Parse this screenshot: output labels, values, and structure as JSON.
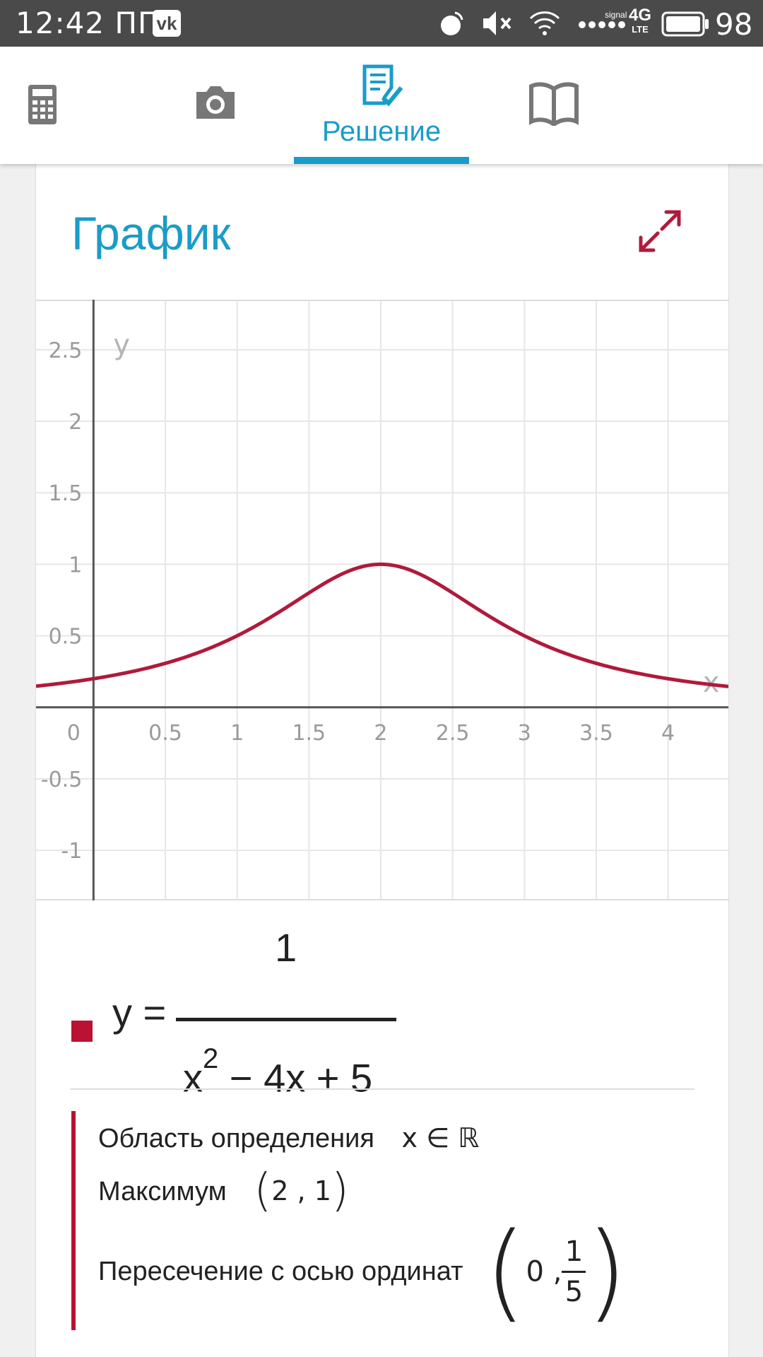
{
  "status_bar": {
    "time": "12:42 ПП",
    "network_small": "signal",
    "network": "4G",
    "network_sub": "LTE",
    "battery": "98"
  },
  "tabs": [
    {
      "icon": "calculator-icon",
      "label": "",
      "active": false
    },
    {
      "icon": "camera-icon",
      "label": "",
      "active": false
    },
    {
      "icon": "solution-icon",
      "label": "Решение",
      "active": true
    },
    {
      "icon": "book-icon",
      "label": "",
      "active": false
    }
  ],
  "card": {
    "title": "График"
  },
  "colors": {
    "accent": "#1a9cc8",
    "curve": "#b01a3c",
    "legend": "#bb1133"
  },
  "chart_data": {
    "type": "line",
    "xlabel": "x",
    "ylabel": "y",
    "xlim": [
      -0.4,
      4.42
    ],
    "ylim": [
      -1.35,
      2.85
    ],
    "x_ticks": [
      "0",
      "0.5",
      "1",
      "1.5",
      "2",
      "2.5",
      "3",
      "3.5",
      "4"
    ],
    "y_ticks": [
      "2.5",
      "2",
      "1.5",
      "1",
      "0.5",
      "-0.5",
      "-1"
    ],
    "series": [
      {
        "function": "1/(x^2-4x+5)",
        "x": [
          -0.4,
          0,
          0.5,
          1,
          1.5,
          2,
          2.5,
          3,
          3.5,
          4,
          4.42
        ],
        "y": [
          0.148,
          0.2,
          0.308,
          0.5,
          0.8,
          1.0,
          0.8,
          0.5,
          0.308,
          0.2,
          0.146
        ]
      }
    ],
    "grid": true
  },
  "formula": {
    "lhs": "y =",
    "numerator": "1",
    "den_base": "x",
    "den_exp": "2",
    "den_rest": " − 4x + 5"
  },
  "properties": {
    "domain_label": "Область определения",
    "domain_value": "x ∈ ℝ",
    "max_label": "Максимум",
    "max_value": "2 , 1",
    "intercept_label": "Пересечение с осью ординат",
    "intercept_x": "0 ,",
    "intercept_num": "1",
    "intercept_den": "5"
  }
}
